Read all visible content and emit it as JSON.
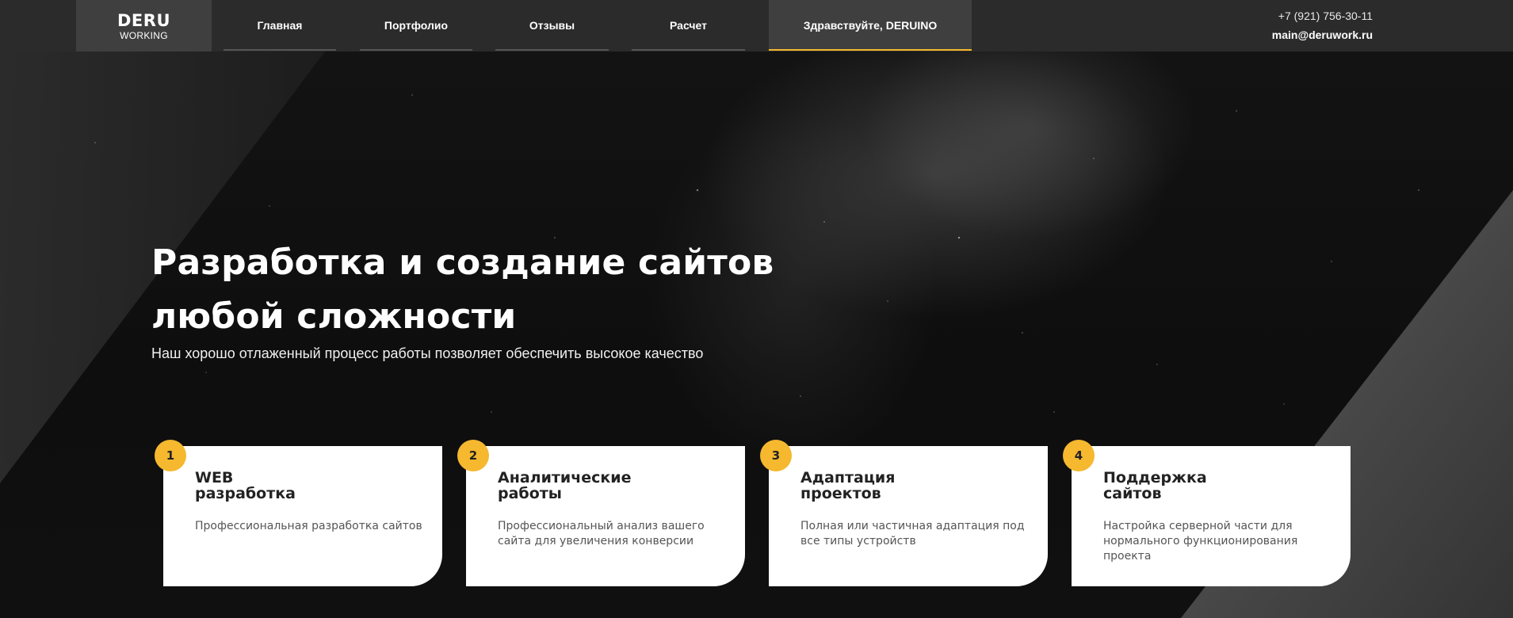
{
  "logo": {
    "main": "DERU",
    "sub": "WORKING"
  },
  "nav": [
    {
      "label": "Главная"
    },
    {
      "label": "Портфолио"
    },
    {
      "label": "Отзывы"
    },
    {
      "label": "Расчет"
    },
    {
      "label": "Здравствуйте, DERUINO"
    }
  ],
  "contacts": {
    "phone": "+7 (921) 756-30-11",
    "email": "main@deruwork.ru"
  },
  "hero": {
    "title_line1": "Разработка и создание сайтов",
    "title_line2": "любой сложности",
    "subtitle": "Наш хорошо отлаженный процесс работы позволяет обеспечить высокое качество"
  },
  "cards": [
    {
      "number": "1",
      "title": "WEB\nразработка",
      "text": "Профессиональная разработка сайтов"
    },
    {
      "number": "2",
      "title": "Аналитические\nработы",
      "text": "Профессиональный анализ вашего сайта для увеличения конверсии"
    },
    {
      "number": "3",
      "title": "Адаптация\nпроектов",
      "text": "Полная или частичная адаптация под все типы устройств"
    },
    {
      "number": "4",
      "title": "Поддержка\nсайтов",
      "text": "Настройка серверной части для нормального функционирования проекта"
    }
  ],
  "colors": {
    "accent": "#f5b82e",
    "header_bg": "#2b2b2b",
    "header_active_bg": "#3f3f3f"
  }
}
